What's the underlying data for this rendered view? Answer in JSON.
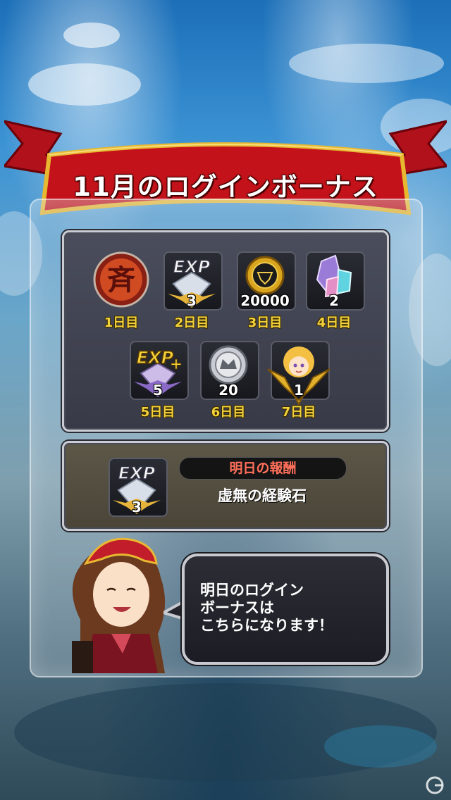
{
  "title": "11月のログインボーナス",
  "days": [
    {
      "label": "1日目",
      "icon": "emblem-icon",
      "qty": ""
    },
    {
      "label": "2日目",
      "icon": "exp-stone-icon",
      "qty": "3"
    },
    {
      "label": "3日目",
      "icon": "gold-coin-icon",
      "qty": "20000"
    },
    {
      "label": "4日目",
      "icon": "crystal-icon",
      "qty": "2"
    },
    {
      "label": "5日目",
      "icon": "exp-plus-icon",
      "qty": "5"
    },
    {
      "label": "6日目",
      "icon": "silver-medal-icon",
      "qty": "20"
    },
    {
      "label": "7日目",
      "icon": "character-unit-icon",
      "qty": "1"
    }
  ],
  "tomorrow": {
    "header": "明日の報酬",
    "name": "虚無の経験石",
    "icon": "exp-stone-icon",
    "qty": "3"
  },
  "speech": "明日のログイン\nボーナスは\nこちらになります！",
  "colors": {
    "ribbon": "#c4121a",
    "ribbon_gold": "#e8b830",
    "day_label": "#f2d23c",
    "header_text": "#ff6f5a"
  }
}
